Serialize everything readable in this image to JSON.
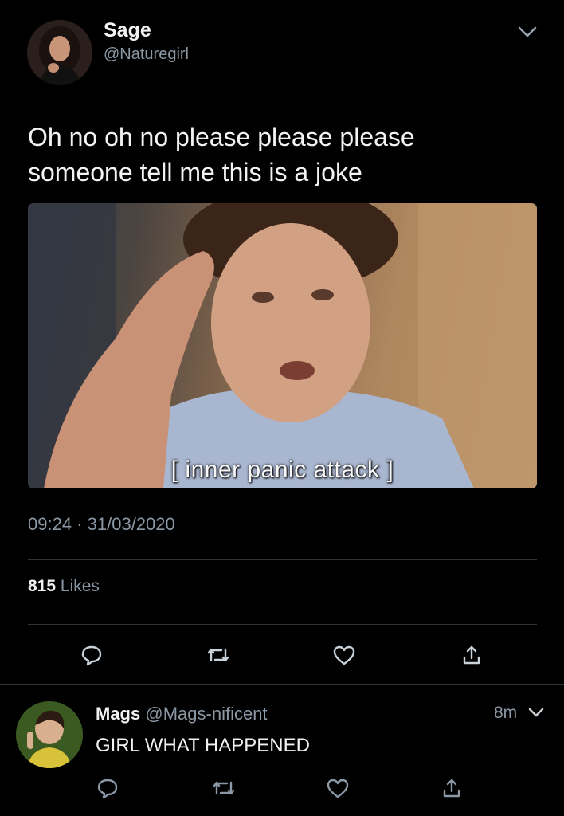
{
  "tweet": {
    "display_name": "Sage",
    "handle": "@Naturegirl",
    "text_line1": "Oh no oh no please please please",
    "text_line2": "someone tell me this is a joke",
    "media_caption": "[ inner panic attack ]",
    "time": "09:24",
    "separator": "·",
    "date": "31/03/2020",
    "likes_count": "815",
    "likes_label": "Likes"
  },
  "reply": {
    "display_name": "Mags",
    "handle": "@Mags-nificent",
    "time": "8m",
    "text": "GIRL WHAT HAPPENED"
  },
  "icons": {
    "menu": "chevron-down-icon",
    "reply": "reply-icon",
    "retweet": "retweet-icon",
    "like": "heart-icon",
    "share": "share-icon"
  },
  "colors": {
    "background": "#000000",
    "primary_text": "#f2f2f2",
    "secondary_text": "#8b98a5",
    "divider": "#2f3336"
  }
}
